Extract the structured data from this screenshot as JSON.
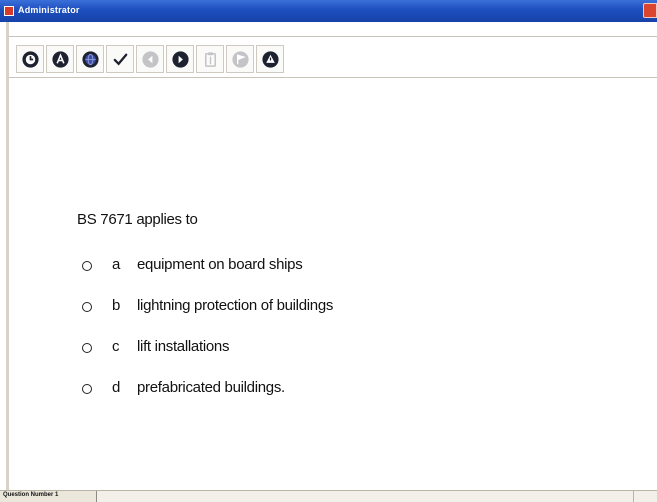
{
  "window": {
    "title": "Administrator"
  },
  "toolbar": {
    "buttons": [
      {
        "name": "clock-icon",
        "enabled": true
      },
      {
        "name": "font-icon",
        "enabled": true
      },
      {
        "name": "globe-icon",
        "enabled": true
      },
      {
        "name": "checkmark-icon",
        "enabled": true
      },
      {
        "name": "previous-arrow-icon",
        "enabled": false
      },
      {
        "name": "next-arrow-icon",
        "enabled": true
      },
      {
        "name": "clipboard-icon",
        "enabled": false
      },
      {
        "name": "flag-icon",
        "enabled": false
      },
      {
        "name": "warning-icon",
        "enabled": true
      }
    ]
  },
  "question": {
    "text": "BS 7671 applies to",
    "options": [
      {
        "letter": "a",
        "text": "equipment on board ships"
      },
      {
        "letter": "b",
        "text": "lightning protection of buildings"
      },
      {
        "letter": "c",
        "text": "lift installations"
      },
      {
        "letter": "d",
        "text": "prefabricated buildings."
      }
    ]
  },
  "status": {
    "question_number": "Question Number 1"
  },
  "colors": {
    "titlebar": "#1d4fbf",
    "icon_active": "#1e2230",
    "icon_disabled": "#b8b8bc"
  }
}
